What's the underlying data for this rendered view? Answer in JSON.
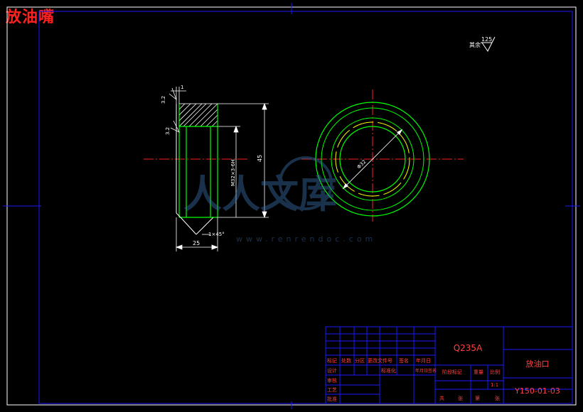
{
  "title": "放油嘴",
  "colors": {
    "background": "#000000",
    "frame": "#1a1aff",
    "outline": "#ffffff",
    "part": "#00ff00",
    "centerline": "#ff2020",
    "thread": "#ffff00",
    "title_text": "#ff2020",
    "table_text": "#ff4040"
  },
  "roughness": {
    "general": "125",
    "general_prefix": "其余",
    "face_top": "3.2",
    "face_side": "3.2"
  },
  "dimensions": {
    "width": "25",
    "height": "45",
    "thread": "M32×3-6H",
    "chamfer": "1×45°",
    "top_gap": "1",
    "diameter": "Φ32"
  },
  "watermark": {
    "text": "人人文库",
    "url": "www.renrendoc.com"
  },
  "title_block": {
    "material": "Q235A",
    "part_name": "放油口",
    "drawing_no": "Y150-01-03",
    "headers": [
      "标记",
      "处数",
      "分区",
      "更改文件号",
      "签名",
      "年月日"
    ],
    "rows": [
      "设计",
      "审核",
      "工艺",
      "批准"
    ],
    "std_label": "标准化",
    "std_sign": "年月日签名",
    "stage_label": "阶段标记",
    "weight_label": "重量",
    "scale_label": "比例",
    "scale": "1:1",
    "sheets_total": "共",
    "sheet_word": "张",
    "sheet_no_label": "第",
    "sheet_word2": "张"
  }
}
